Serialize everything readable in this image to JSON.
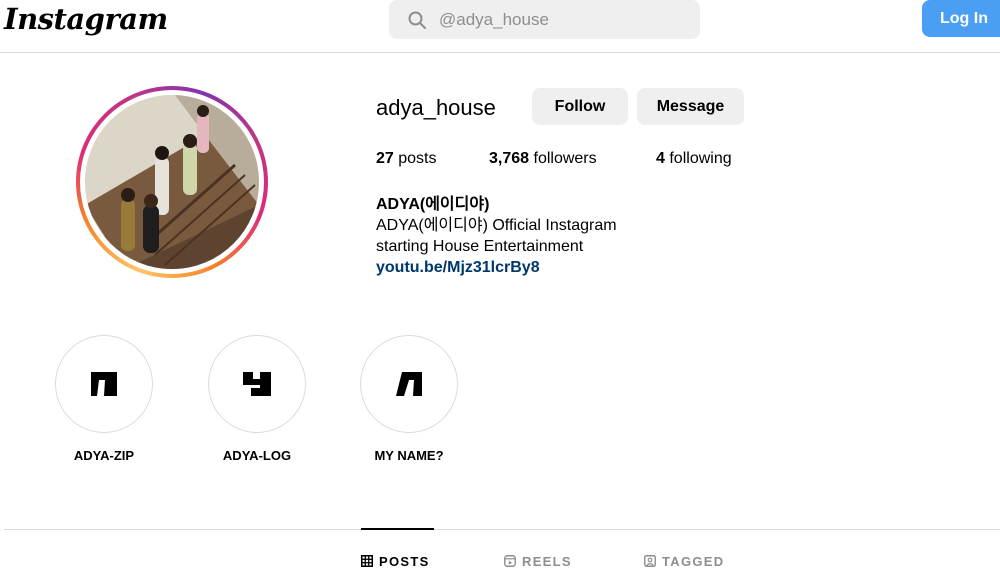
{
  "header": {
    "logo": "Instagram",
    "search_placeholder": "@adya_house",
    "login_label": "Log In"
  },
  "profile": {
    "username": "adya_house",
    "follow_label": "Follow",
    "message_label": "Message",
    "stats": {
      "posts_count": "27",
      "posts_label": "posts",
      "followers_count": "3,768",
      "followers_label": "followers",
      "following_count": "4",
      "following_label": "following"
    },
    "bio": {
      "name": "ADYA(에이디야)",
      "line1": "ADYA(에이디야) Official Instagram",
      "line2": "starting House Entertainment",
      "link": "youtu.be/Mjz31lcrBy8"
    }
  },
  "highlights": [
    {
      "label": "ADYA-ZIP",
      "icon": "adya-a-glyph-icon"
    },
    {
      "label": "ADYA-LOG",
      "icon": "adya-d-glyph-icon"
    },
    {
      "label": "MY NAME?",
      "icon": "adya-y-glyph-icon"
    }
  ],
  "tabs": [
    {
      "label": "POSTS",
      "icon": "grid-icon",
      "active": true
    },
    {
      "label": "REELS",
      "icon": "reels-icon",
      "active": false
    },
    {
      "label": "TAGGED",
      "icon": "tagged-icon",
      "active": false
    }
  ],
  "colors": {
    "login_button": "#4a9ff5",
    "link": "#00376b",
    "border": "#dbdbdb",
    "button_gray": "#efefef"
  }
}
